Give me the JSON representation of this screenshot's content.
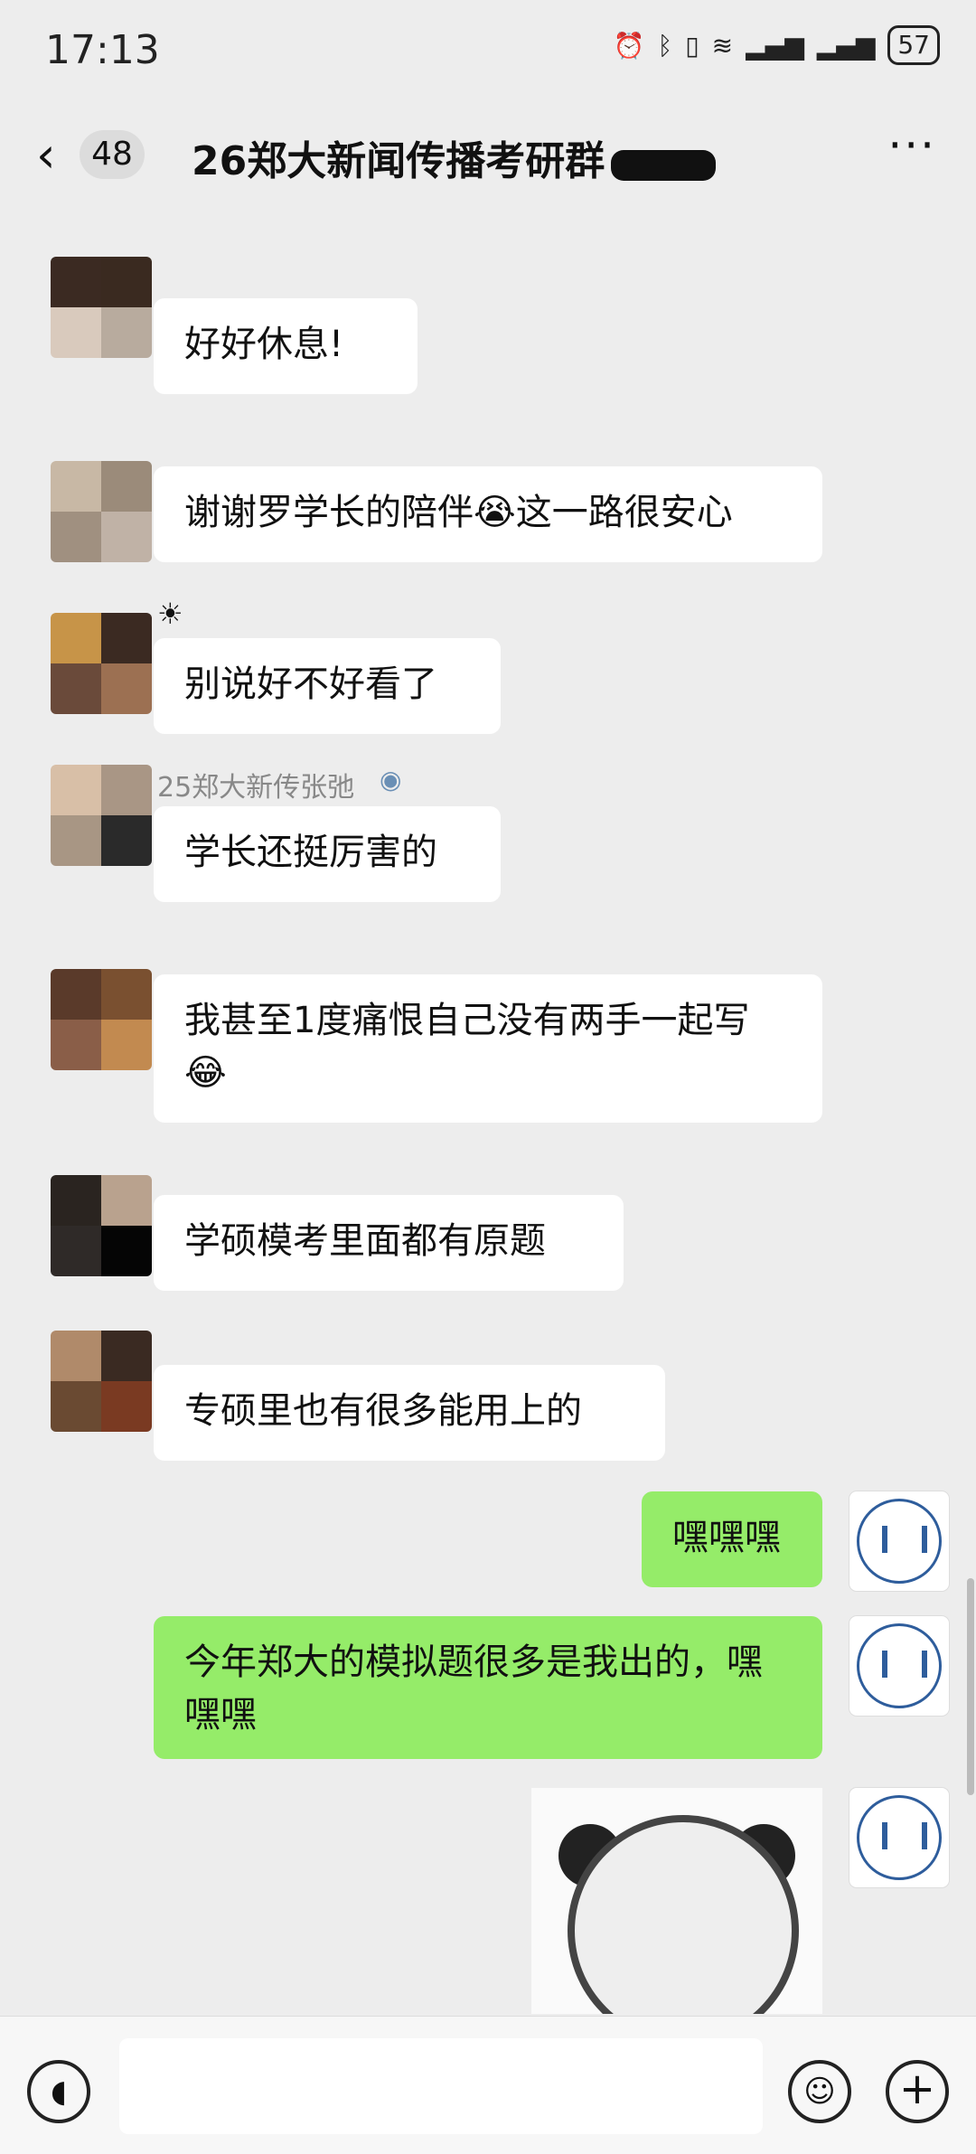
{
  "status": {
    "time": "17:13",
    "battery": "57"
  },
  "header": {
    "back_count": "48",
    "title": "26郑大新闻传播考研群"
  },
  "messages": [
    {
      "text": "好好休息!"
    },
    {
      "text": "谢谢罗学长的陪伴😭这一路很安心"
    },
    {
      "text": "别说好不好看了"
    },
    {
      "sender": "25郑大新传张弛",
      "text": "学长还挺厉害的"
    },
    {
      "text": "我甚至1度痛恨自己没有两手一起写😂"
    },
    {
      "text": "学硕模考里面都有原题"
    },
    {
      "text": "专硕里也有很多能用上的"
    },
    {
      "text": "嘿嘿嘿",
      "self": true
    },
    {
      "text": "今年郑大的模拟题很多是我出的，嘿嘿嘿",
      "self": true
    }
  ],
  "input": {
    "placeholder": ""
  },
  "colors": {
    "background": "#ededed",
    "self_bubble": "#95ec69",
    "other_bubble": "#ffffff"
  }
}
